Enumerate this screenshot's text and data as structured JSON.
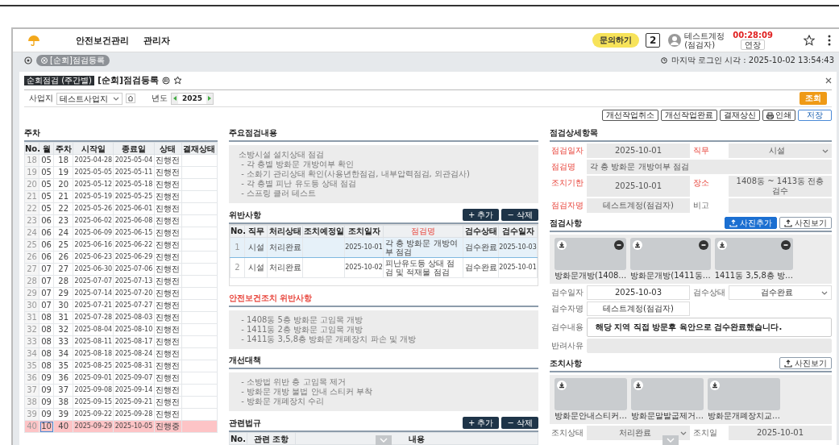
{
  "header": {
    "brand": "안전보건관리",
    "menu": [
      "관리자"
    ],
    "inquiry_button": "문의하기",
    "calendar_day": "2",
    "user_name": "테스트계정",
    "user_role": "(점검자)",
    "timer": "00:28:09",
    "extend_button": "연장"
  },
  "tabs": [
    {
      "label": "[순회]점검등록",
      "selected": true
    }
  ],
  "last_login": "마지막 로그인 시각 : 2025-10-02 13:54:43",
  "page": {
    "badge": "순회점검 (주간별)",
    "title": "[순회]점검등록"
  },
  "filters": {
    "site_label": "사업지",
    "site_value": "테스트사업지",
    "year_label": "년도",
    "year_value": "2025",
    "search_button": "조회"
  },
  "actions": [
    {
      "label": "개선작업취소",
      "kind": "plain"
    },
    {
      "label": "개선작업완료",
      "kind": "plain"
    },
    {
      "label": "결재상신",
      "kind": "plain"
    },
    {
      "label": "인쇄",
      "kind": "print"
    },
    {
      "label": "저장",
      "kind": "primary"
    }
  ],
  "weeks": {
    "title": "주차",
    "columns": [
      "No.",
      "월",
      "주차",
      "시작일",
      "종료일",
      "상태",
      "결재상태"
    ],
    "rows": [
      {
        "cells": [
          "18",
          "05",
          "18",
          "2025-04-28",
          "2025-05-04",
          "진행전"
        ],
        "selected": false
      },
      {
        "cells": [
          "19",
          "05",
          "19",
          "2025-05-05",
          "2025-05-11",
          "진행전"
        ],
        "selected": false
      },
      {
        "cells": [
          "20",
          "05",
          "20",
          "2025-05-12",
          "2025-05-18",
          "진행전"
        ],
        "selected": false
      },
      {
        "cells": [
          "21",
          "05",
          "21",
          "2025-05-19",
          "2025-05-25",
          "진행전"
        ],
        "selected": false
      },
      {
        "cells": [
          "22",
          "05",
          "22",
          "2025-05-26",
          "2025-06-01",
          "진행전"
        ],
        "selected": false
      },
      {
        "cells": [
          "23",
          "06",
          "23",
          "2025-06-02",
          "2025-06-08",
          "진행전"
        ],
        "selected": false
      },
      {
        "cells": [
          "24",
          "06",
          "24",
          "2025-06-09",
          "2025-06-15",
          "진행전"
        ],
        "selected": false
      },
      {
        "cells": [
          "25",
          "06",
          "25",
          "2025-06-16",
          "2025-06-22",
          "진행전"
        ],
        "selected": false
      },
      {
        "cells": [
          "26",
          "06",
          "26",
          "2025-06-23",
          "2025-06-29",
          "진행전"
        ],
        "selected": false
      },
      {
        "cells": [
          "27",
          "07",
          "27",
          "2025-06-30",
          "2025-07-06",
          "진행전"
        ],
        "selected": false
      },
      {
        "cells": [
          "28",
          "07",
          "28",
          "2025-07-07",
          "2025-07-13",
          "진행전"
        ],
        "selected": false
      },
      {
        "cells": [
          "29",
          "07",
          "29",
          "2025-07-14",
          "2025-07-20",
          "진행전"
        ],
        "selected": false
      },
      {
        "cells": [
          "30",
          "07",
          "30",
          "2025-07-21",
          "2025-07-27",
          "진행전"
        ],
        "selected": false
      },
      {
        "cells": [
          "31",
          "08",
          "31",
          "2025-07-28",
          "2025-08-03",
          "진행전"
        ],
        "selected": false
      },
      {
        "cells": [
          "32",
          "08",
          "32",
          "2025-08-04",
          "2025-08-10",
          "진행전"
        ],
        "selected": false
      },
      {
        "cells": [
          "33",
          "08",
          "33",
          "2025-08-11",
          "2025-08-17",
          "진행전"
        ],
        "selected": false
      },
      {
        "cells": [
          "34",
          "08",
          "34",
          "2025-08-18",
          "2025-08-24",
          "진행전"
        ],
        "selected": false
      },
      {
        "cells": [
          "35",
          "08",
          "35",
          "2025-08-25",
          "2025-08-31",
          "진행전"
        ],
        "selected": false
      },
      {
        "cells": [
          "36",
          "09",
          "36",
          "2025-09-01",
          "2025-09-07",
          "진행전"
        ],
        "selected": false
      },
      {
        "cells": [
          "37",
          "09",
          "37",
          "2025-09-08",
          "2025-09-14",
          "진행전"
        ],
        "selected": false
      },
      {
        "cells": [
          "38",
          "09",
          "38",
          "2025-09-15",
          "2025-09-21",
          "진행전"
        ],
        "selected": false
      },
      {
        "cells": [
          "39",
          "09",
          "39",
          "2025-09-22",
          "2025-09-28",
          "진행전"
        ],
        "selected": false
      },
      {
        "cells": [
          "40",
          "10",
          "40",
          "2025-09-29",
          "2025-10-05",
          "진행중"
        ],
        "selected": true
      }
    ]
  },
  "main_content": {
    "title": "주요점검내용",
    "required": false,
    "lines": [
      "소방시설 설치상태 점검",
      " - 각 층별 방화문 개방여부 확인",
      " - 소화기 관리상태 확인(사용년한점검, 내부압력점검, 외관검사)",
      " - 각 층별 피난 유도등 상태 점검",
      " - 스프링 클러 테스트"
    ]
  },
  "violations": {
    "title": "위반사항",
    "add_button": "+ 추가",
    "delete_button": "− 삭제",
    "columns": [
      {
        "label": "No.",
        "required": false
      },
      {
        "label": "직무",
        "required": false
      },
      {
        "label": "처리상태",
        "required": false
      },
      {
        "label": "조치예정일",
        "required": false
      },
      {
        "label": "조치일자",
        "required": false
      },
      {
        "label": "점검명",
        "required": true
      },
      {
        "label": "검수상태",
        "required": false
      },
      {
        "label": "검수일자",
        "required": false
      }
    ],
    "rows": [
      {
        "no": "1",
        "duty": "시설",
        "process_status": "처리완료",
        "action_date": "2025-10-01",
        "name": "각 층 방화문 개방여부 점검",
        "review_status": "검수완료",
        "review_date": "2025-10-03",
        "selected": true
      },
      {
        "no": "2",
        "duty": "시설",
        "process_status": "처리완료",
        "action_date": "2025-10-02",
        "name": "피난유도등 상태 점검 및 적재물 점검",
        "review_status": "검수완료",
        "review_date": "2025-10-01",
        "selected": false
      }
    ]
  },
  "safety_violations": {
    "title": "안전보건조치 위반사항",
    "required": true,
    "lines": [
      " - 1408동 5층 방화문 고임목 개방",
      " - 1411동 2층 방화문 고임목 개방",
      " - 1411동 3,5,8층 방화문 개폐장치 파손 및 개방"
    ]
  },
  "improvements": {
    "title": "개선대책",
    "required": false,
    "lines": [
      " - 소방법 위반 층 고임목 제거",
      " - 방화문 개방 불법 안내 스티커 부착",
      " - 방화문 개폐장치 수리"
    ]
  },
  "laws": {
    "title": "관련법규",
    "add_button": "+ 추가",
    "delete_button": "− 삭제",
    "columns": [
      "No.",
      "관련 조항",
      "내용"
    ]
  },
  "detail": {
    "title": "점검상세항목",
    "rows": [
      [
        {
          "label": "점검일자",
          "value": "2025-10-01",
          "required": true,
          "kind": "text",
          "disabled": true
        },
        {
          "label": "직무",
          "value": "시설",
          "required": true,
          "kind": "select",
          "disabled": true
        }
      ],
      [
        {
          "label": "점검명",
          "value": "각 층 방화문 개방여부 점검",
          "required": true,
          "kind": "wide",
          "disabled": true
        }
      ],
      [
        {
          "label": "조치기한",
          "value": "2025-10-01",
          "required": true,
          "kind": "text",
          "disabled": true
        },
        {
          "label": "장소",
          "value": "1408동 ~ 1413동 전층 검수",
          "required": true,
          "kind": "text",
          "disabled": true
        }
      ],
      [
        {
          "label": "점검자명",
          "value": "테스트계정(점검자)",
          "required": true,
          "kind": "text",
          "disabled": true
        },
        {
          "label": "비고",
          "required": false,
          "kind": "text",
          "disabled": true
        }
      ]
    ]
  },
  "inspection": {
    "title": "점검사항",
    "add_photo_button": "사진추가",
    "view_photo_button": "사진보기",
    "photos": [
      {
        "caption": "방화문개방(1408…",
        "removable": true
      },
      {
        "caption": "방화문개방(1411동…",
        "removable": true
      },
      {
        "caption": "1411동 3,5,8층 방…",
        "removable": true
      }
    ],
    "rows": [
      [
        {
          "label": "검수일자",
          "value": "2025-10-03",
          "required": false,
          "kind": "text",
          "disabled": false
        },
        {
          "label": "검수상태",
          "value": "검수완료",
          "required": false,
          "kind": "select",
          "disabled": false
        }
      ],
      [
        {
          "label": "검수자명",
          "value": "테스트계정(점검자)",
          "required": false,
          "kind": "text",
          "disabled": false
        }
      ]
    ],
    "review": {
      "label": "검수내용",
      "value": "해당 지역 직접 방문후 육안으로 검수완료했습니다."
    },
    "reject": {
      "label": "반려사유"
    }
  },
  "action": {
    "title": "조치사항",
    "view_photo_button": "사진보기",
    "photos": [
      {
        "caption": "방화문안내스티커…",
        "removable": false
      },
      {
        "caption": "방화문말발굽제거…",
        "removable": false
      },
      {
        "caption": "방화문개폐장치교…",
        "removable": false
      }
    ],
    "rows": [
      [
        {
          "label": "조치상태",
          "value": "처리완료",
          "required": false,
          "kind": "select",
          "disabled": true
        },
        {
          "label": "조치일",
          "value": "2025-10-01",
          "required": false,
          "kind": "text",
          "disabled": true
        }
      ]
    ]
  }
}
